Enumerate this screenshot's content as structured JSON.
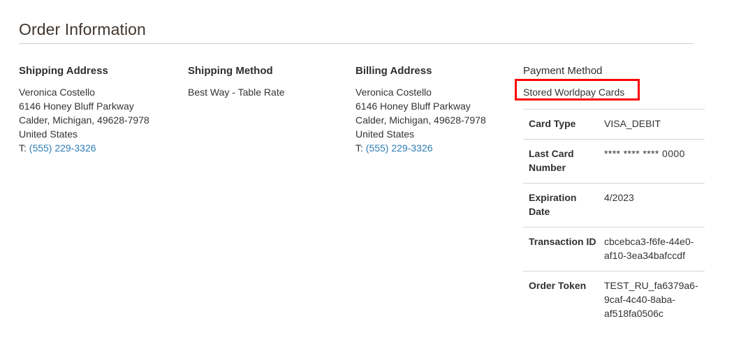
{
  "section": {
    "title": "Order Information"
  },
  "columns": {
    "shipping_address": {
      "heading": "Shipping Address",
      "name": "Veronica Costello",
      "street": "6146 Honey Bluff Parkway",
      "city_state_zip": "Calder, Michigan, 49628-7978",
      "country": "United States",
      "phone_prefix": "T:",
      "phone": "(555) 229-3326"
    },
    "shipping_method": {
      "heading": "Shipping Method",
      "value": "Best Way - Table Rate"
    },
    "billing_address": {
      "heading": "Billing Address",
      "name": "Veronica Costello",
      "street": "6146 Honey Bluff Parkway",
      "city_state_zip": "Calder, Michigan, 49628-7978",
      "country": "United States",
      "phone_prefix": "T:",
      "phone": "(555) 229-3326"
    },
    "payment_method": {
      "heading": "Payment Method",
      "title": "Stored Worldpay Cards",
      "highlight_color": "#ff0000",
      "details": [
        {
          "label": "Card Type",
          "value": "VISA_DEBIT"
        },
        {
          "label": "Last Card Number",
          "value": "**** **** **** 0000"
        },
        {
          "label": "Expiration Date",
          "value": "4/2023"
        },
        {
          "label": "Transaction ID",
          "value": "cbcebca3-f6fe-44e0-af10-3ea34bafccdf"
        },
        {
          "label": "Order Token",
          "value": "TEST_RU_fa6379a6-9caf-4c40-8aba-af518fa0506c"
        }
      ]
    }
  }
}
